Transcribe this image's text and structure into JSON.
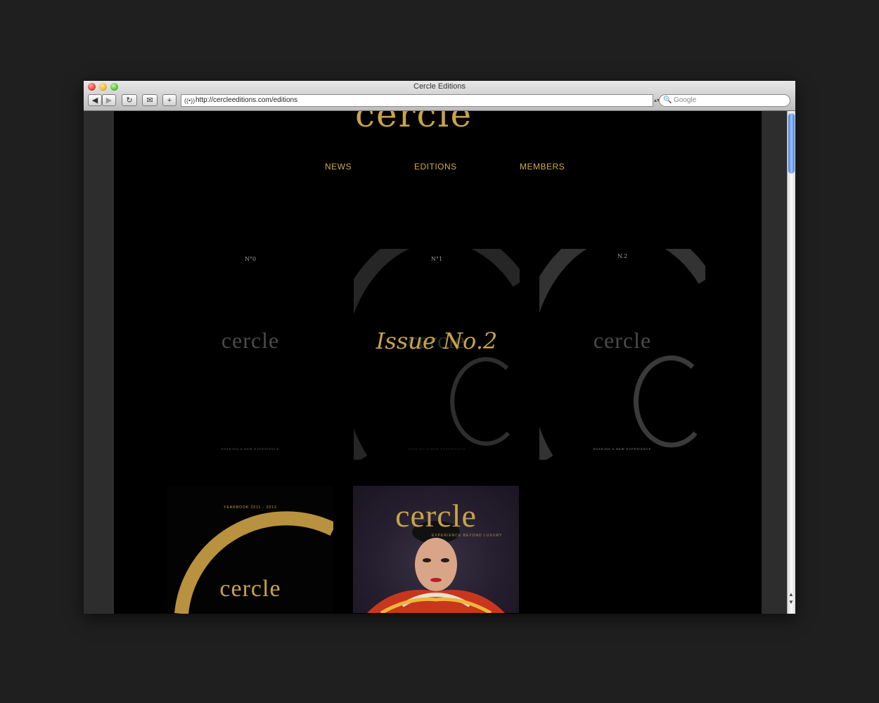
{
  "window": {
    "title": "Cercle Editions"
  },
  "toolbar": {
    "back_label": "◀",
    "forward_label": "▶",
    "reload_label": "↻",
    "bookmarks_label": "✉",
    "add_label": "+"
  },
  "address": {
    "url": "http://cercleeditions.com/editions"
  },
  "search": {
    "placeholder": "Google"
  },
  "site": {
    "logo": "cercle",
    "nav": [
      {
        "label": "NEWS"
      },
      {
        "label": "EDITIONS"
      },
      {
        "label": "MEMBERS"
      }
    ]
  },
  "editions": [
    {
      "number": "N°0",
      "wordmark": "cercle",
      "tagline": "SHARING A NEW EXPERIENCE"
    },
    {
      "number": "N°1",
      "wordmark": "cercle",
      "tagline": "SHARING A NEW EXPERIENCE",
      "hover_label": "Issue No.2"
    },
    {
      "number": "N.2",
      "wordmark": "cercle",
      "tagline": "SHARING A NEW EXPERIENCE"
    },
    {
      "yearbook": "YEARBOOK 2011 - 2012",
      "wordmark": "cercle"
    },
    {
      "title": "cercle",
      "tagline": "EXPERIENCE BEYOND LUXURY"
    }
  ],
  "colors": {
    "accent_gold": "#c9a24a",
    "site_bg": "#000000",
    "desk_bg": "#1f1f1f"
  },
  "icons": [
    "rss-icon",
    "search-icon",
    "scroll-up-icon",
    "scroll-down-icon"
  ]
}
